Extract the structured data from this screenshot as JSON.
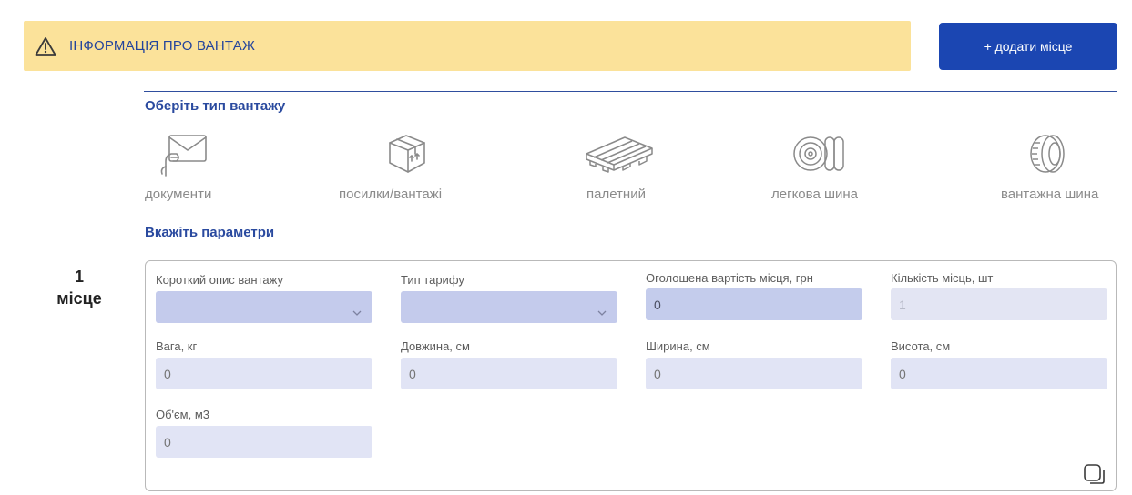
{
  "banner": {
    "title": "ІНФОРМАЦІЯ ПРО ВАНТАЖ",
    "icon": "warning-triangle-icon"
  },
  "add_button": {
    "label": "+ додати місце"
  },
  "cargo_type": {
    "title": "Оберіть тип вантажу",
    "types": [
      {
        "label": "документи",
        "icon": "documents-icon"
      },
      {
        "label": "посилки/вантажі",
        "icon": "parcel-box-icon"
      },
      {
        "label": "палетний",
        "icon": "pallet-icon"
      },
      {
        "label": "легкова шина",
        "icon": "car-tire-icon"
      },
      {
        "label": "вантажна шина",
        "icon": "truck-tire-icon"
      }
    ]
  },
  "params": {
    "title": "Вкажіть параметри",
    "place": {
      "number": "1",
      "label": "місце"
    },
    "fields": {
      "description": {
        "label": "Короткий опис вантажу",
        "value": ""
      },
      "tariff": {
        "label": "Тип тарифу",
        "value": ""
      },
      "declared_value": {
        "label": "Оголошена вартість місця, грн",
        "value": "0"
      },
      "quantity": {
        "label": "Кількість місць, шт",
        "value": "1"
      },
      "weight": {
        "label": "Вага, кг",
        "placeholder": "0"
      },
      "length": {
        "label": "Довжина, см",
        "placeholder": "0"
      },
      "width": {
        "label": "Ширина, см",
        "placeholder": "0"
      },
      "height": {
        "label": "Висота, см",
        "placeholder": "0"
      },
      "volume": {
        "label": "Об'єм, м3",
        "placeholder": "0"
      }
    }
  },
  "colors": {
    "banner_bg": "#fbe29a",
    "accent": "#1b46b2",
    "heading": "#2a4a9f",
    "input_bg": "#e1e4f5",
    "select_bg": "#c4cbec"
  }
}
